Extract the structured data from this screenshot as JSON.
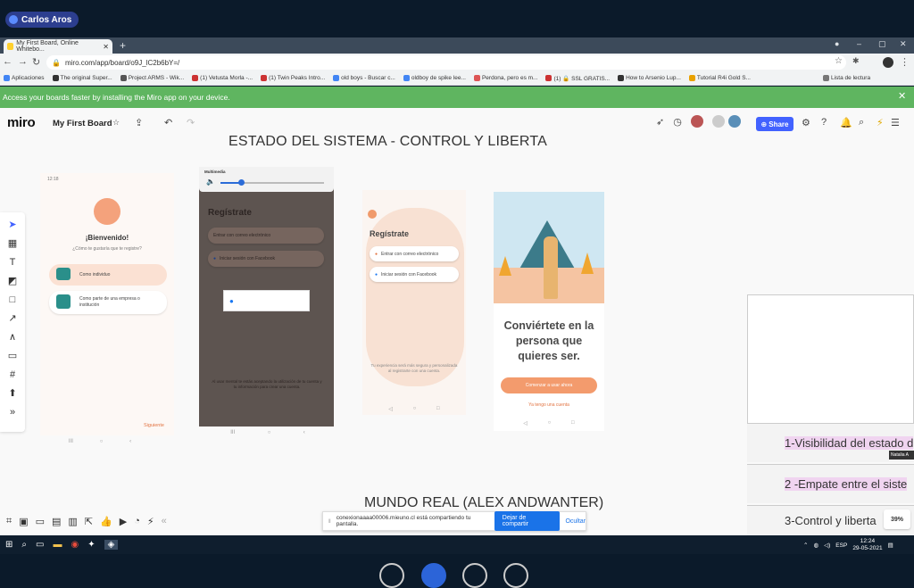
{
  "meeting": {
    "speaker": "Carlos Aros"
  },
  "browser": {
    "tab_title": "My First Board, Online Whitebo...",
    "url": "miro.com/app/board/o9J_lC2b6bY=/",
    "bookmarks": [
      "Aplicaciones",
      "The original Super...",
      "Project ARMS - Wik...",
      "(1) Vetusta Morla -...",
      "(1) Twin Peaks Intro...",
      "old boys - Buscar c...",
      "oldboy de spike lee...",
      "Perdona, pero es m...",
      "(1) 🔒 SSL GRATIS...",
      "How to Arsenio Lup...",
      "Tutorial R4i Gold S...",
      "Lista de lectura"
    ],
    "banner": "Access your boards faster by installing the Miro app on your device."
  },
  "miro": {
    "logo": "miro",
    "board_name": "My First Board",
    "share_label": "Share",
    "zoom": "39%"
  },
  "board": {
    "title_top": "ESTADO DEL SISTEMA - CONTROL Y LIBERTA",
    "title_bottom": "MUNDO REAL (ALEX ANDWANTER)",
    "phone1": {
      "status": "12:18",
      "welcome": "¡Bienvenido!",
      "question": "¿Cómo te gustaría que te registre?",
      "option1": "Como individuo",
      "option2": "Como parte de una empresa o institución",
      "next": "Siguiente"
    },
    "phone2": {
      "header": "Multimedia",
      "title": "Regístrate",
      "opt1": "Entrar con correo electrónico",
      "opt2": "Iniciar sesión con Facebook",
      "legal": "Al usar mental te estás aceptando la utilización de tu cuenta y tu información para crear una cuenta."
    },
    "phone3": {
      "title": "Regístrate",
      "opt1": "Entrar con correo electrónico",
      "opt2": "Iniciar sesión con Facebook",
      "legal": "Tu experiencia será más segura y personalizada al registrarte con una cuenta."
    },
    "phone4": {
      "headline": "Conviértete en la persona que quieres ser.",
      "cta": "Comenzar a usar ahora",
      "secondary": "Ya tengo una cuenta"
    },
    "heuristics": [
      "1-Visibilidad del estado d",
      "2 -Empate entre el siste",
      "3-Control y liberta"
    ],
    "cursor_label": "Natalia A"
  },
  "share_notice": {
    "text": "conexionaaaa00006.mieuno.cl está compartiendo tu pantalla.",
    "stop_label": "Dejar de compartir",
    "hide_label": "Ocultar"
  },
  "taskbar": {
    "lang": "ESP",
    "time": "12:24",
    "date": "29-05-2021"
  }
}
